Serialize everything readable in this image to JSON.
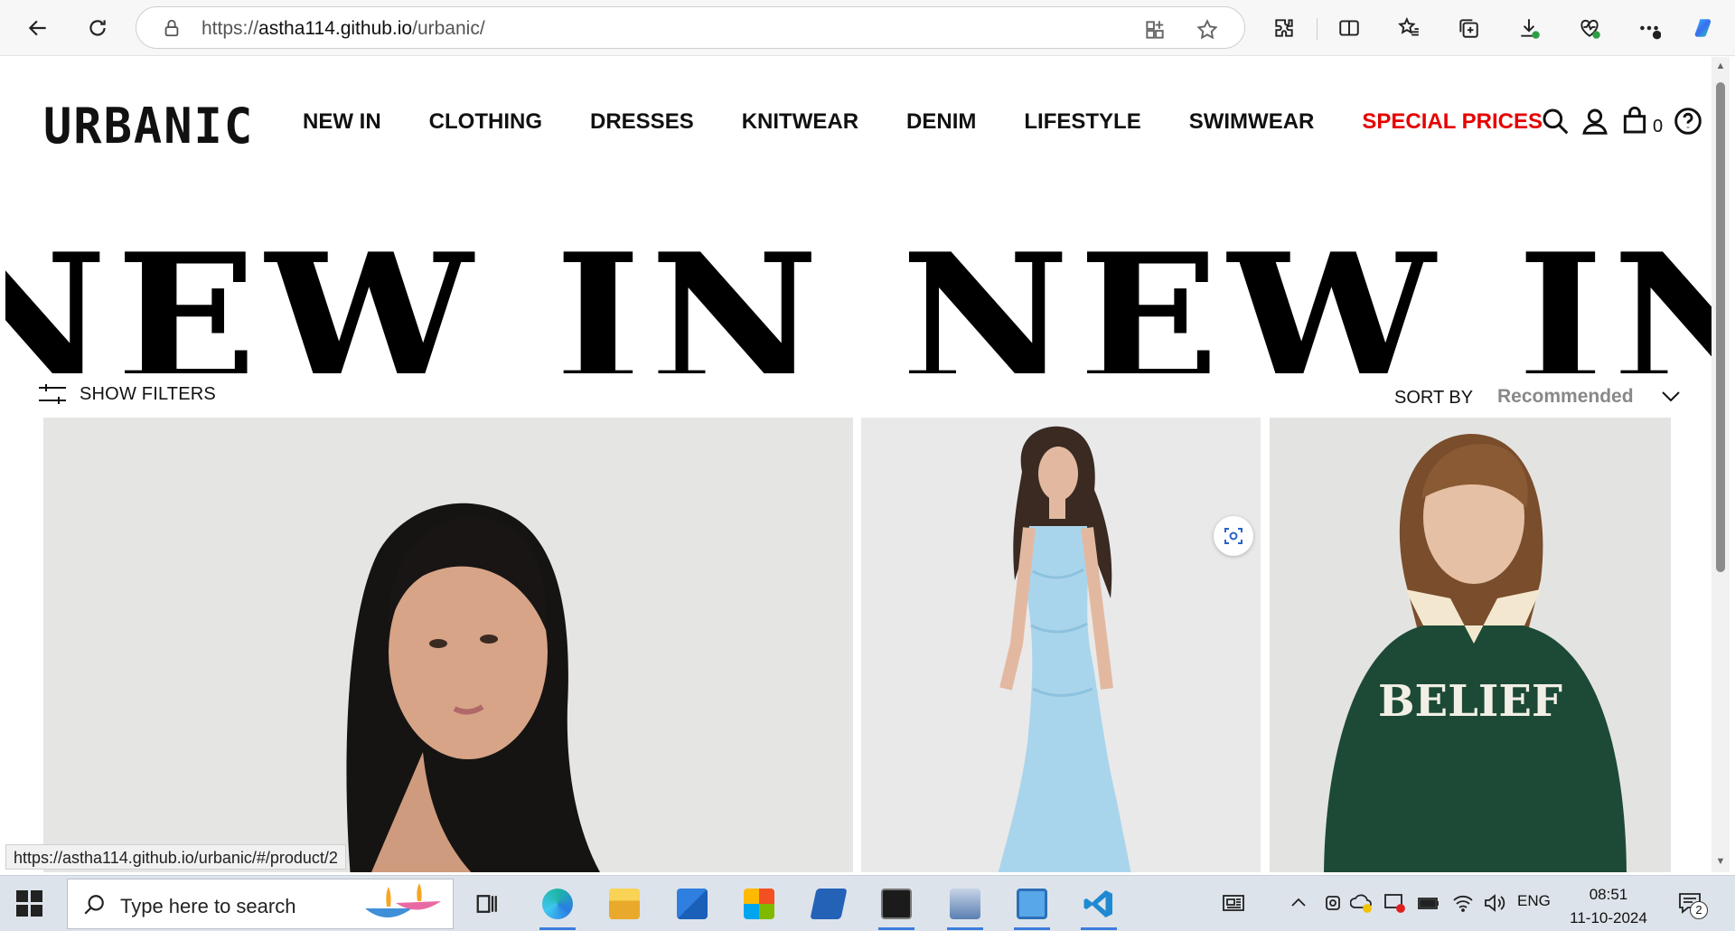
{
  "browser": {
    "url_protocol": "https://",
    "url_host": "astha114.github.io",
    "url_path": "/urbanic/",
    "icons": [
      "back-icon",
      "refresh-icon",
      "lock-icon",
      "app-available-icon",
      "favorite-star-icon",
      "extensions-icon",
      "split-screen-icon",
      "favorites-icon",
      "collections-icon",
      "downloads-icon",
      "browser-essentials-icon",
      "more-icon",
      "copilot-icon"
    ]
  },
  "site": {
    "logo": "URBANIC",
    "nav": [
      "NEW IN",
      "CLOTHING",
      "DRESSES",
      "KNITWEAR",
      "DENIM",
      "LIFESTYLE",
      "SWIMWEAR",
      "SPECIAL PRICES"
    ],
    "special_color": "#e60000",
    "cart_count": "0",
    "banner_text": "NEW IN NEW IN NEW IN NEW"
  },
  "filters": {
    "show_filters": "SHOW FILTERS",
    "sort_by": "SORT BY",
    "sort_value": "Recommended"
  },
  "products": [
    {
      "image": "woman-dark-hair-portrait"
    },
    {
      "image": "light-blue-maxi-dress"
    },
    {
      "image": "green-believe-sweatshirt",
      "print": "BELIEF"
    }
  ],
  "status_bar": {
    "hover_url": "https://astha114.github.io/urbanic/#/product/2"
  },
  "taskbar": {
    "search_placeholder": "Type here to search",
    "language": "ENG",
    "time": "08:51",
    "date": "11-10-2024",
    "notification_count": "2",
    "apps": [
      "task-view",
      "edge",
      "file-explorer",
      "mail",
      "microsoft-store",
      "powershell",
      "terminal",
      "network-tool",
      "control-panel",
      "vscode"
    ]
  }
}
